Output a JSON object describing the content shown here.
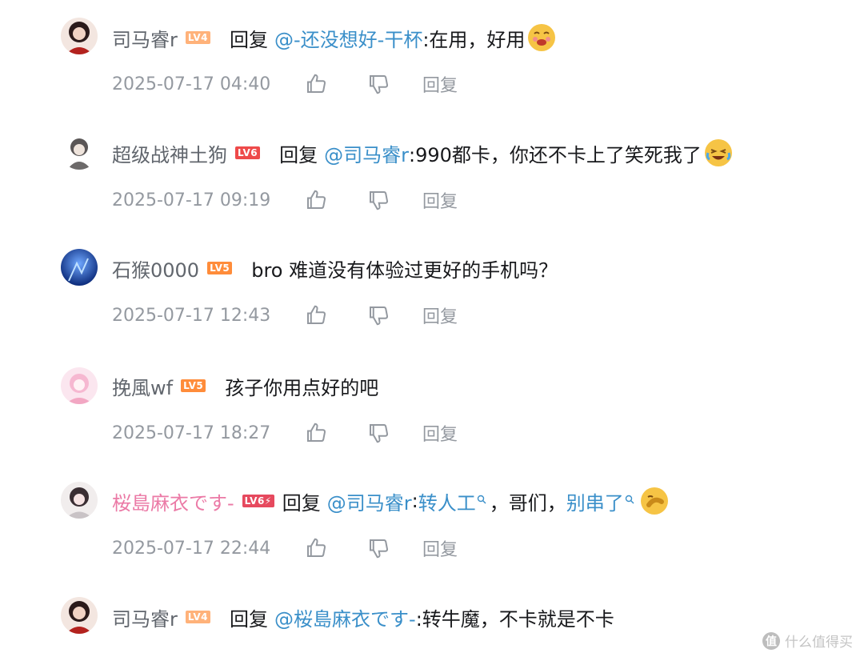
{
  "comments": [
    {
      "username": "司马睿r",
      "level": "LV4",
      "reply_word": "回复",
      "mention": "@-还没想好-干杯",
      "text": ":在用，好用",
      "time": "2025-07-17 04:40",
      "reply_action": "回复"
    },
    {
      "username": "超级战神土狗",
      "level": "LV6",
      "reply_word": "回复",
      "mention": "@司马睿r",
      "text": ":990都卡，你还不卡上了笑死我了",
      "time": "2025-07-17 09:19",
      "reply_action": "回复"
    },
    {
      "username": "石猴0000",
      "level": "LV5",
      "text": "bro 难道没有体验过更好的手机吗？",
      "time": "2025-07-17 12:43",
      "reply_action": "回复"
    },
    {
      "username": "挽風wf",
      "level": "LV5",
      "text": "孩子你用点好的吧",
      "time": "2025-07-17 18:27",
      "reply_action": "回复"
    },
    {
      "username": "桜島麻衣です-",
      "level": "LV6⚡",
      "reply_word": "回复",
      "mention": "@司马睿r",
      "text_a": ":",
      "link_a": "转人工",
      "text_b": "，哥们，",
      "link_b": "别串了",
      "time": "2025-07-17 22:44",
      "reply_action": "回复"
    },
    {
      "username": "司马睿r",
      "level": "LV4",
      "reply_word": "回复",
      "mention": "@桜島麻衣です-",
      "text": ":转牛魔，不卡就是不卡"
    }
  ],
  "watermark": {
    "badge": "值",
    "text": "什么值得买"
  },
  "colors": {
    "mention": "#3a8fc9",
    "meta": "#9499a0",
    "pink_name": "#eb7aa6"
  },
  "icons": [
    "like-icon",
    "dislike-icon",
    "search-icon",
    "emoji-yum",
    "emoji-laugh-cry",
    "emoji-facepalm"
  ]
}
